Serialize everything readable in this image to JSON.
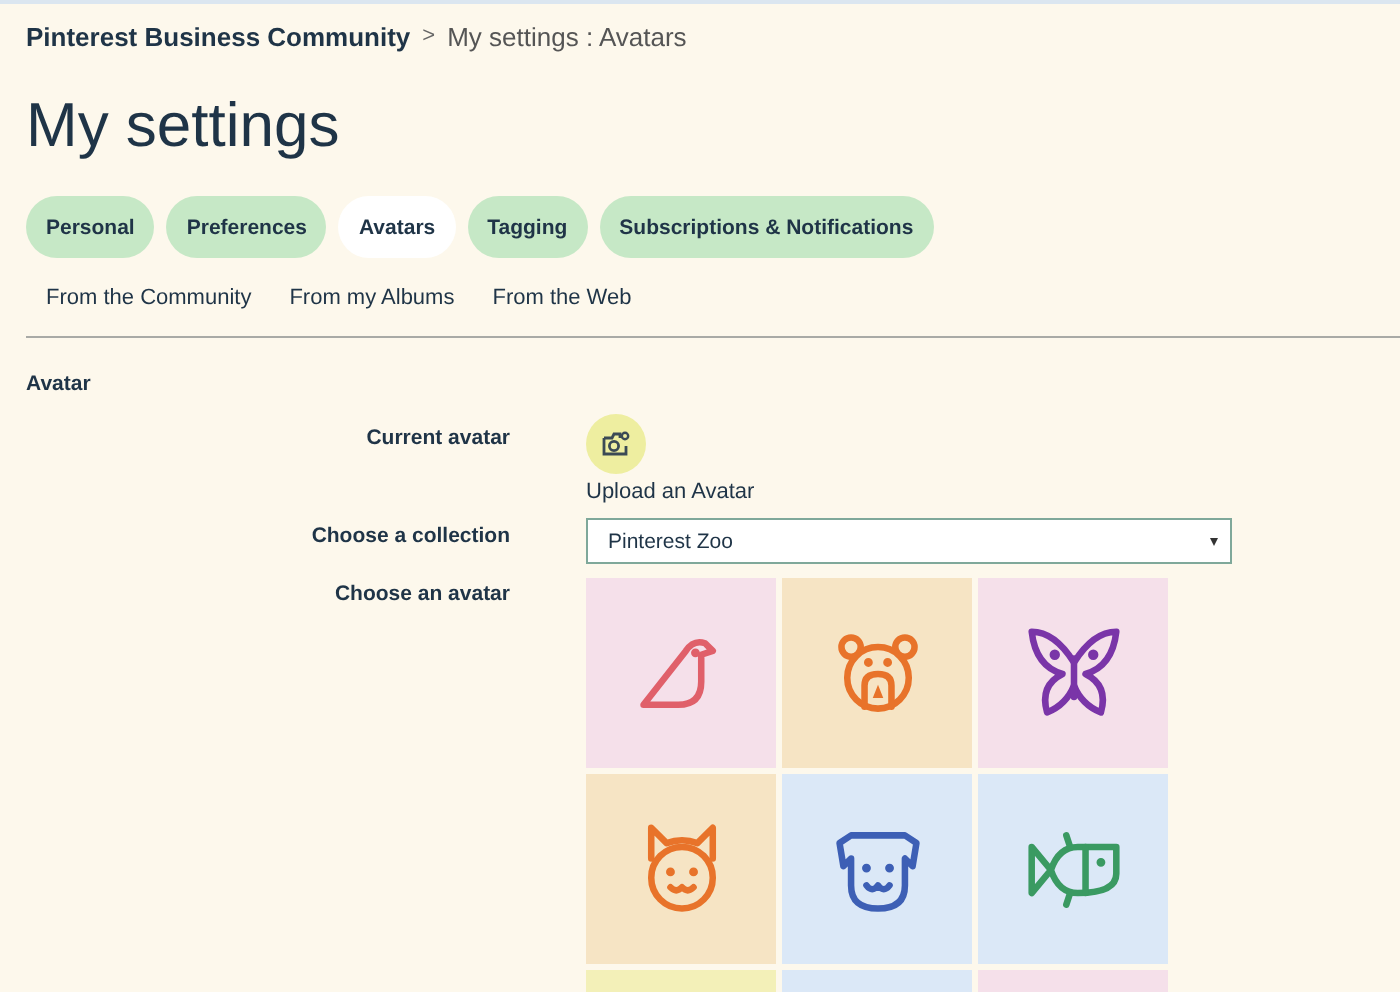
{
  "breadcrumb": {
    "home": "Pinterest Business Community",
    "separator": ">",
    "current": "My settings : Avatars"
  },
  "title": "My settings",
  "tabs": [
    {
      "label": "Personal",
      "selected": false
    },
    {
      "label": "Preferences",
      "selected": false
    },
    {
      "label": "Avatars",
      "selected": true
    },
    {
      "label": "Tagging",
      "selected": false
    },
    {
      "label": "Subscriptions & Notifications",
      "selected": false
    }
  ],
  "subtabs": [
    "From the Community",
    "From my Albums",
    "From the Web"
  ],
  "section": "Avatar",
  "current_avatar": {
    "label": "Current avatar",
    "upload": "Upload an Avatar"
  },
  "collection": {
    "label": "Choose a collection",
    "value": "Pinterest Zoo"
  },
  "avatars": {
    "label": "Choose an avatar",
    "tiles": [
      {
        "kind": "bird",
        "color": "#f5e0ea"
      },
      {
        "kind": "bear",
        "color": "#f6e4c4"
      },
      {
        "kind": "butterfly",
        "color": "#f5e0ea"
      },
      {
        "kind": "cat",
        "color": "#f6e4c4"
      },
      {
        "kind": "dog",
        "color": "#dbe8f7"
      },
      {
        "kind": "fish",
        "color": "#dbe8f7"
      },
      {
        "color": "#f3f0b8"
      },
      {
        "color": "#dbe8f7"
      },
      {
        "color": "#f5e0ea"
      }
    ]
  }
}
